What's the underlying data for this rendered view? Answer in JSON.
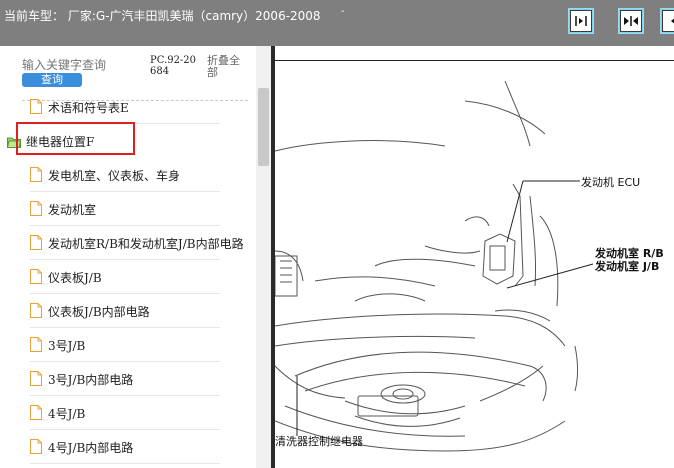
{
  "header": {
    "title": "当前车型： 厂家:G-广汽丰田凯美瑞（camry）2006-2008",
    "dot": "-",
    "buttons": [
      {
        "name": "expand-icon"
      },
      {
        "name": "collapse-icon"
      },
      {
        "name": "prev-icon"
      }
    ]
  },
  "search": {
    "placeholder": "输入关键字查询",
    "query_label": "查询",
    "pc_code": "PC.92-20684",
    "fold_all_label": "折叠全部"
  },
  "tree": {
    "items": [
      {
        "label": "术语和符号表E",
        "type": "doc"
      },
      {
        "label": "继电器位置F",
        "type": "folder",
        "selected": true
      },
      {
        "label": "发电机室、仪表板、车身",
        "type": "doc"
      },
      {
        "label": "发动机室",
        "type": "doc"
      },
      {
        "label": "发动机室R/B和发动机室J/B内部电路",
        "type": "doc"
      },
      {
        "label": "仪表板J/B",
        "type": "doc"
      },
      {
        "label": "仪表板J/B内部电路",
        "type": "doc"
      },
      {
        "label": "3号J/B",
        "type": "doc"
      },
      {
        "label": "3号J/B内部电路",
        "type": "doc"
      },
      {
        "label": "4号J/B",
        "type": "doc"
      },
      {
        "label": "4号J/B内部电路",
        "type": "doc"
      }
    ]
  },
  "diagram": {
    "labels": {
      "ecu": "发动机 ECU",
      "rb": "发动机室 R/B",
      "jb": "发动机室 J/B",
      "washer": "清洗器控制继电器"
    }
  },
  "colors": {
    "titlebar": "#7f7f7f",
    "button_accent": "#7fd3ec",
    "query_button": "#3a8edb",
    "highlight": "#e02020"
  }
}
